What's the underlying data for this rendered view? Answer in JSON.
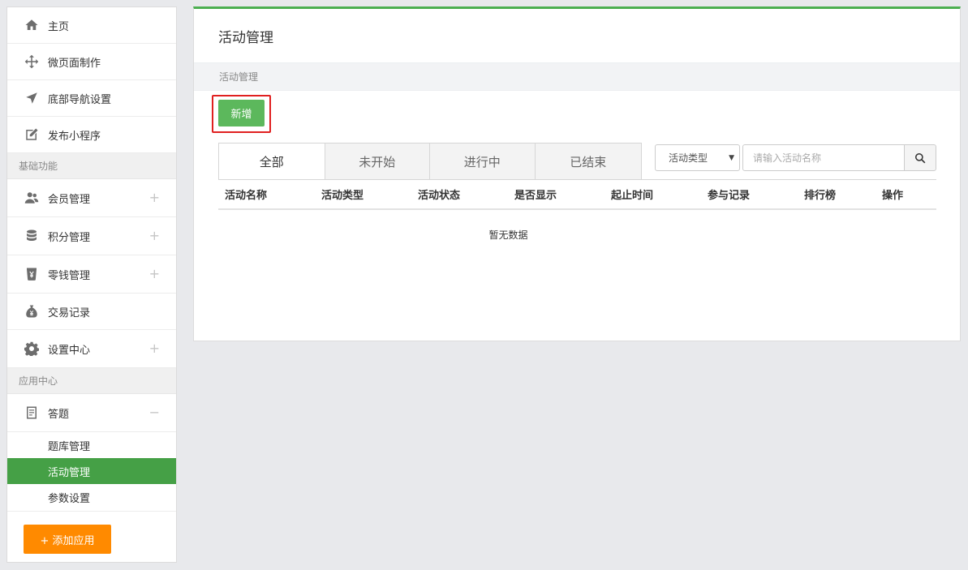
{
  "sidebar": {
    "top_items": [
      {
        "label": "主页",
        "icon": "home-icon"
      },
      {
        "label": "微页面制作",
        "icon": "move-icon"
      },
      {
        "label": "底部导航设置",
        "icon": "navigation-arrow-icon"
      },
      {
        "label": "发布小程序",
        "icon": "edit-icon"
      }
    ],
    "section_basic": "基础功能",
    "basic_items": [
      {
        "label": "会员管理",
        "icon": "users-icon",
        "toggle": "+"
      },
      {
        "label": "积分管理",
        "icon": "database-icon",
        "toggle": "+"
      },
      {
        "label": "零钱管理",
        "icon": "yen-cup-icon",
        "toggle": "+"
      },
      {
        "label": "交易记录",
        "icon": "money-bag-icon"
      },
      {
        "label": "设置中心",
        "icon": "gear-icon",
        "toggle": "+"
      }
    ],
    "section_apps": "应用中心",
    "app_group": {
      "label": "答题",
      "icon": "document-icon",
      "toggle": "−"
    },
    "app_subitems": [
      {
        "label": "题库管理",
        "active": false
      },
      {
        "label": "活动管理",
        "active": true
      },
      {
        "label": "参数设置",
        "active": false
      }
    ],
    "add_app_label": "+ 添加应用"
  },
  "main": {
    "title": "活动管理",
    "breadcrumb": "活动管理",
    "new_button": "新增",
    "tabs": [
      "全部",
      "未开始",
      "进行中",
      "已结束"
    ],
    "type_select": "活动类型",
    "search_placeholder": "请输入活动名称",
    "columns": [
      "活动名称",
      "活动类型",
      "活动状态",
      "是否显示",
      "起止时间",
      "参与记录",
      "排行榜",
      "操作"
    ],
    "empty_text": "暂无数据"
  },
  "colors": {
    "accent_green": "#45a046",
    "button_green": "#5cb85c",
    "orange": "#ff8a00",
    "highlight_red": "#e02020"
  }
}
